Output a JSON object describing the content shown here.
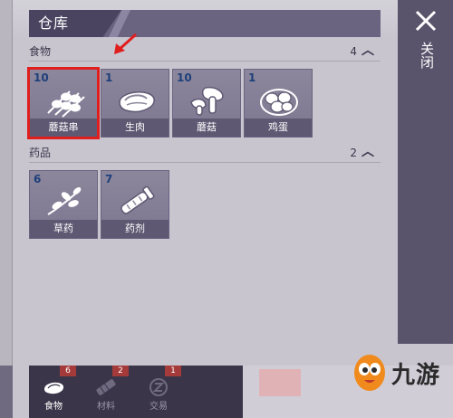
{
  "window": {
    "title": "仓库",
    "close_label": "关闭"
  },
  "sections": [
    {
      "name": "食物",
      "count": "4",
      "items": [
        {
          "qty": "10",
          "name": "蘑菇串",
          "icon": "mushroom-skewer-icon",
          "selected": true
        },
        {
          "qty": "1",
          "name": "生肉",
          "icon": "raw-meat-icon",
          "selected": false
        },
        {
          "qty": "10",
          "name": "蘑菇",
          "icon": "mushroom-icon",
          "selected": false
        },
        {
          "qty": "1",
          "name": "鸡蛋",
          "icon": "eggs-icon",
          "selected": false
        }
      ]
    },
    {
      "name": "药品",
      "count": "2",
      "items": [
        {
          "qty": "6",
          "name": "草药",
          "icon": "herb-icon",
          "selected": false
        },
        {
          "qty": "7",
          "name": "药剂",
          "icon": "potion-vial-icon",
          "selected": false
        }
      ]
    }
  ],
  "bottom_tabs": [
    {
      "label": "食物",
      "badge": "6",
      "icon": "food-icon",
      "active": true
    },
    {
      "label": "材料",
      "badge": "2",
      "icon": "material-icon",
      "active": false
    },
    {
      "label": "交易",
      "badge": "1",
      "icon": "trade-icon",
      "active": false
    }
  ],
  "watermark": {
    "text": "九游"
  },
  "colors": {
    "highlight": "#e01e1e",
    "panel": "#c8c5cf",
    "slot": "#8c879c",
    "qty_text": "#1e3f7a"
  }
}
